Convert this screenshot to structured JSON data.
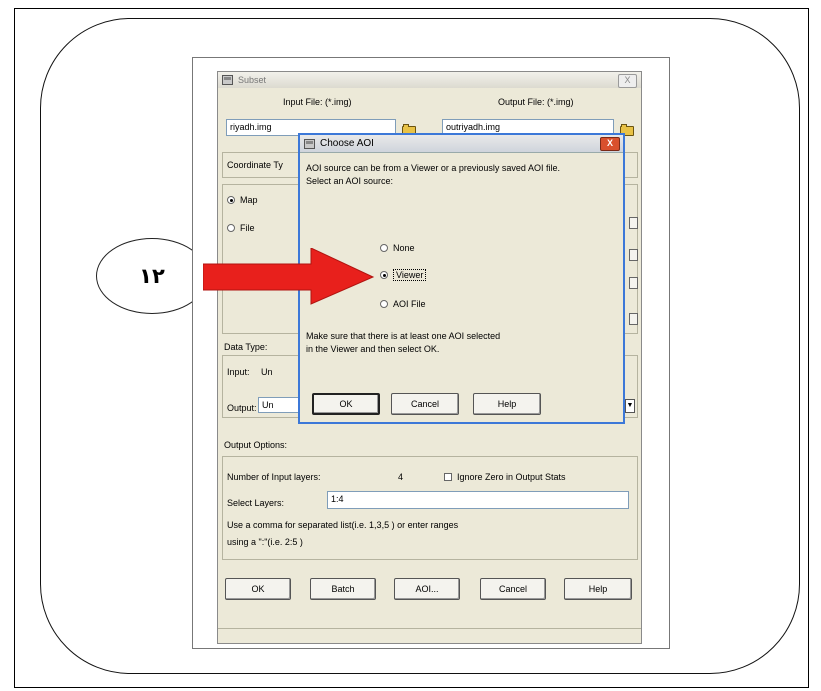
{
  "step_number": "۱۲",
  "subset": {
    "title": "Subset",
    "close_label": "X",
    "input_file_label": "Input File: (*.img)",
    "input_file_value": "riyadh.img",
    "output_file_label": "Output File: (*.img)",
    "output_file_value": "outriyadh.img",
    "coordinate_type_label": "Coordinate Ty",
    "map_option": "Map",
    "file_option": "File",
    "data_type_label": "Data Type:",
    "input_label": "Input:",
    "input_type_value": "Un",
    "output_label": "Output:",
    "output_type_value": "Un",
    "output_options_label": "Output Options:",
    "num_layers_label": "Number of Input layers:",
    "num_layers_value": "4",
    "ignore_zero_label": "Ignore Zero in Output Stats",
    "select_layers_label": "Select Layers:",
    "select_layers_value": "1:4",
    "hint_line1": "Use a comma for separated list(i.e. 1,3,5 ) or enter ranges",
    "hint_line2": "using a \":\"(i.e. 2:5 )",
    "buttons": {
      "ok": "OK",
      "batch": "Batch",
      "aoi": "AOI...",
      "cancel": "Cancel",
      "help": "Help"
    }
  },
  "aoi_dialog": {
    "title": "Choose AOI",
    "close_label": "X",
    "intro_line1": "AOI source can be from a Viewer or a previously saved AOI file.",
    "intro_line2": "Select an AOI source:",
    "options": {
      "none": "None",
      "viewer": "Viewer",
      "aoi_file": "AOI File"
    },
    "selected": "Viewer",
    "note_line1": "Make sure that there is at least one AOI selected",
    "note_line2": "in the Viewer and then select OK.",
    "buttons": {
      "ok": "OK",
      "cancel": "Cancel",
      "help": "Help"
    }
  },
  "colors": {
    "arrow": "#e8201c",
    "dialog_frame": "#3c78d8",
    "window_bg": "#ece9d8"
  }
}
